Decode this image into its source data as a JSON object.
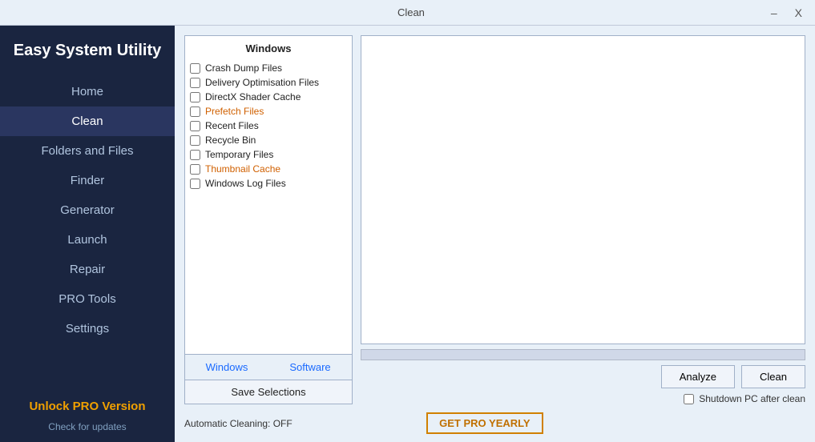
{
  "window": {
    "title": "Clean",
    "minimize_label": "–",
    "close_label": "X"
  },
  "sidebar": {
    "logo_text": "Easy System Utility",
    "nav_items": [
      {
        "id": "home",
        "label": "Home",
        "active": false
      },
      {
        "id": "clean",
        "label": "Clean",
        "active": true
      },
      {
        "id": "folders-and-files",
        "label": "Folders and Files",
        "active": false
      },
      {
        "id": "finder",
        "label": "Finder",
        "active": false
      },
      {
        "id": "generator",
        "label": "Generator",
        "active": false
      },
      {
        "id": "launch",
        "label": "Launch",
        "active": false
      },
      {
        "id": "repair",
        "label": "Repair",
        "active": false
      },
      {
        "id": "pro-tools",
        "label": "PRO Tools",
        "active": false
      },
      {
        "id": "settings",
        "label": "Settings",
        "active": false
      }
    ],
    "unlock_pro_label": "Unlock PRO Version",
    "check_updates_label": "Check for updates"
  },
  "left_panel": {
    "section_header": "Windows",
    "checklist_items": [
      {
        "id": "crash-dump",
        "label": "Crash Dump Files",
        "checked": false,
        "orange": false
      },
      {
        "id": "delivery-opt",
        "label": "Delivery Optimisation Files",
        "checked": false,
        "orange": false
      },
      {
        "id": "directx",
        "label": "DirectX Shader Cache",
        "checked": false,
        "orange": false
      },
      {
        "id": "prefetch",
        "label": "Prefetch Files",
        "checked": false,
        "orange": true
      },
      {
        "id": "recent",
        "label": "Recent Files",
        "checked": false,
        "orange": false
      },
      {
        "id": "recycle",
        "label": "Recycle Bin",
        "checked": false,
        "orange": false
      },
      {
        "id": "temp-files",
        "label": "Temporary Files",
        "checked": false,
        "orange": false
      },
      {
        "id": "thumbnail",
        "label": "Thumbnail Cache",
        "checked": false,
        "orange": true
      },
      {
        "id": "windows-log",
        "label": "Windows Log Files",
        "checked": false,
        "orange": false
      }
    ],
    "tabs": [
      {
        "id": "windows-tab",
        "label": "Windows",
        "active": true
      },
      {
        "id": "software-tab",
        "label": "Software",
        "active": false
      }
    ],
    "save_label": "Save Selections"
  },
  "right_panel": {
    "output_text": "",
    "progress": 0,
    "analyze_label": "Analyze",
    "clean_label": "Clean",
    "shutdown_label": "Shutdown PC after clean",
    "shutdown_checked": false,
    "auto_clean_text": "Automatic Cleaning: OFF"
  },
  "bottom": {
    "get_pro_label": "GET PRO YEARLY"
  }
}
